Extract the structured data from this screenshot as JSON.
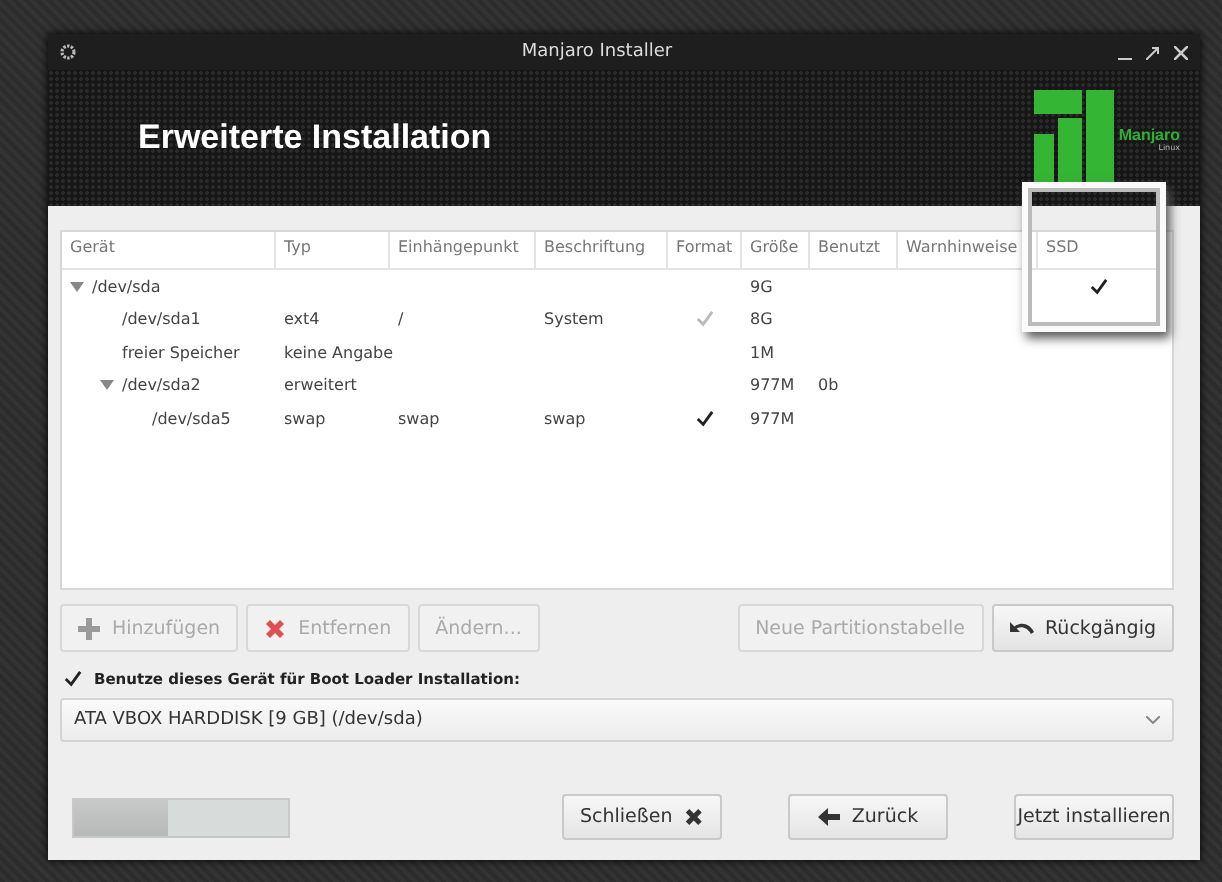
{
  "window": {
    "title": "Manjaro Installer"
  },
  "header": {
    "title": "Erweiterte Installation",
    "logo_name": "Manjaro",
    "logo_sub": "Linux"
  },
  "table": {
    "columns": [
      "Gerät",
      "Typ",
      "Einhängepunkt",
      "Beschriftung",
      "Format",
      "Größe",
      "Benutzt",
      "Warnhinweise",
      "SSD"
    ],
    "rows": [
      {
        "device": "/dev/sda",
        "size": "9G",
        "expanded": true,
        "ssd": {
          "checked": true
        },
        "children": [
          {
            "device": "/dev/sda1",
            "type": "ext4",
            "mount": "/",
            "label": "System",
            "format": {
              "checked": true,
              "disabled": true
            },
            "size": "8G"
          },
          {
            "device": "freier Speicher",
            "type": "keine Angabe",
            "size": "1M"
          },
          {
            "device": "/dev/sda2",
            "type": "erweitert",
            "size": "977M",
            "used": "0b",
            "expanded": true,
            "children": [
              {
                "device": "/dev/sda5",
                "type": "swap",
                "mount": "swap",
                "label": "swap",
                "format": {
                  "checked": true,
                  "disabled": false
                },
                "size": "977M"
              }
            ]
          }
        ]
      }
    ]
  },
  "partition_buttons": [
    {
      "label": "Hinzufügen",
      "kind": "add",
      "disabled": true
    },
    {
      "label": "Entfernen",
      "kind": "remove",
      "disabled": true
    },
    {
      "label": "Ändern...",
      "kind": "text",
      "disabled": true
    }
  ],
  "partition_buttons_right": [
    {
      "label": "Neue Partitionstabelle",
      "kind": "text",
      "disabled": true
    },
    {
      "label": "Rückgängig",
      "kind": "undo",
      "disabled": false
    }
  ],
  "bootloader": {
    "label": "Benutze dieses Gerät für Boot Loader Installation:",
    "checked": true,
    "device": "ATA VBOX HARDDISK [9 GB] (/dev/sda)"
  },
  "progress": {
    "level": 0.44
  },
  "nav_buttons": [
    {
      "label": "Schließen",
      "kind": "close",
      "disabled": false
    },
    {
      "label": "Zurück",
      "kind": "back",
      "disabled": false
    },
    {
      "label": "Jetzt installieren",
      "kind": "text",
      "disabled": false
    }
  ]
}
